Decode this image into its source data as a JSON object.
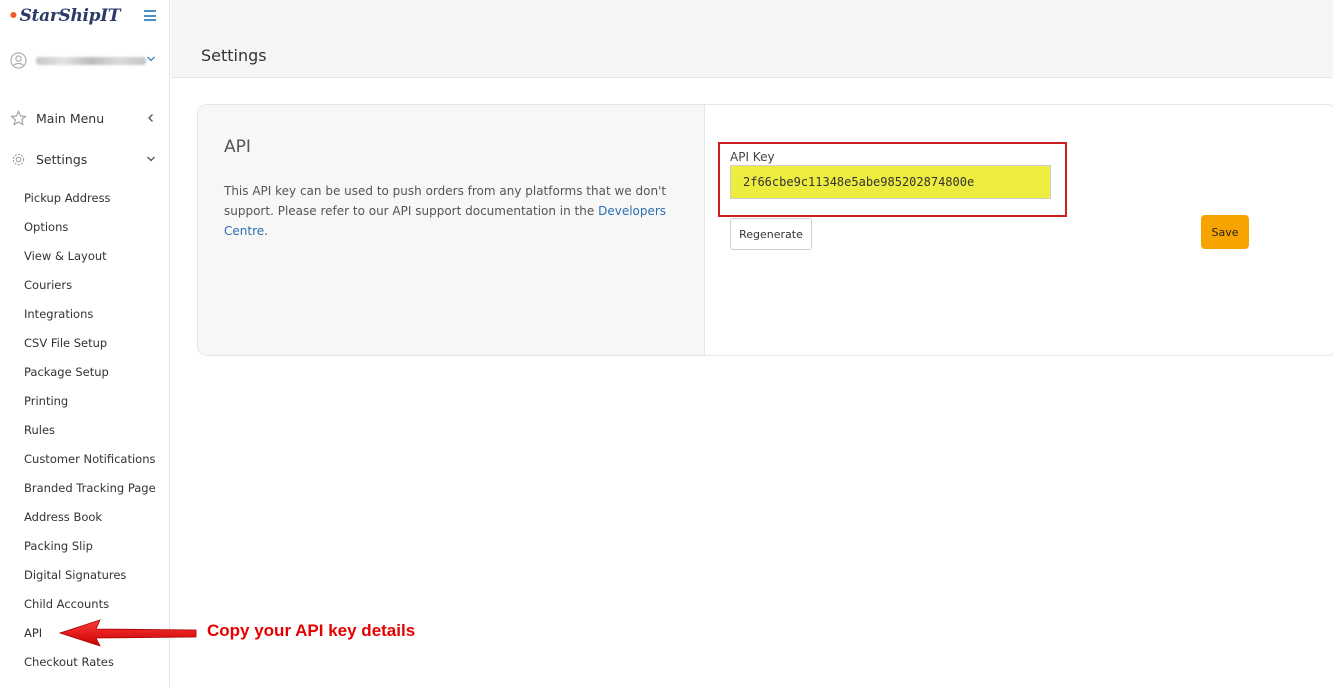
{
  "sidebar": {
    "logo_text": "StarShipIT",
    "main_menu_label": "Main Menu",
    "settings_label": "Settings",
    "items": [
      {
        "label": "Pickup Address"
      },
      {
        "label": "Options"
      },
      {
        "label": "View & Layout"
      },
      {
        "label": "Couriers"
      },
      {
        "label": "Integrations"
      },
      {
        "label": "CSV File Setup"
      },
      {
        "label": "Package Setup"
      },
      {
        "label": "Printing"
      },
      {
        "label": "Rules"
      },
      {
        "label": "Customer Notifications"
      },
      {
        "label": "Branded Tracking Page"
      },
      {
        "label": "Address Book"
      },
      {
        "label": "Packing Slip"
      },
      {
        "label": "Digital Signatures"
      },
      {
        "label": "Child Accounts"
      },
      {
        "label": "API"
      },
      {
        "label": "Checkout Rates"
      }
    ]
  },
  "header": {
    "title": "Settings"
  },
  "api_card": {
    "title": "API",
    "description": "This API key can be used to push orders from any platforms that we don't support. Please refer to our API support documentation in the",
    "link_text": "Developers Centre",
    "description_end": ".",
    "field_label": "API Key",
    "api_key_value": "2f66cbe9c11348e5abe985202874800e",
    "regenerate_label": "Regenerate",
    "save_label": "Save"
  },
  "annotation": {
    "callout_text": "Copy your API key details"
  },
  "colors": {
    "accent_link": "#2f6fb0",
    "save_button": "#f7a400",
    "highlight": "#eded3f",
    "annotation_red": "#e60000"
  },
  "icons": {
    "logo": "starshipit-logo",
    "menu_toggle": "hamburger-icon",
    "user": "user-icon",
    "main_menu": "star-icon",
    "settings": "gear-icon"
  }
}
